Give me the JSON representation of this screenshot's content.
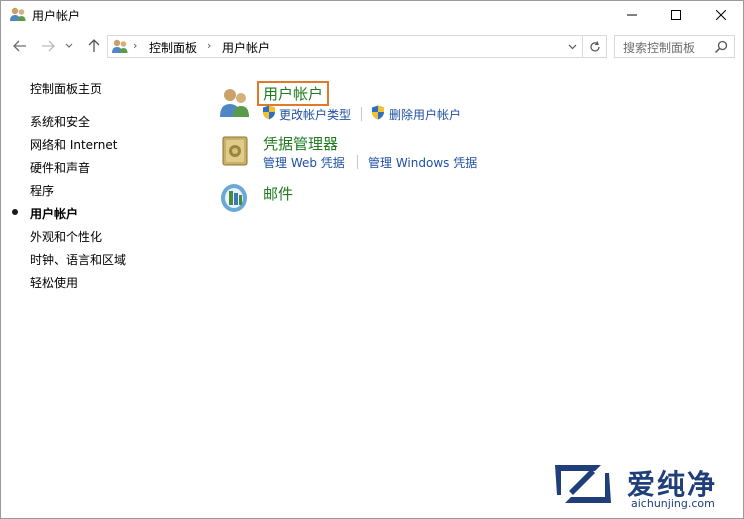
{
  "window": {
    "title": "用户帐户",
    "controls": {
      "minimize": "—",
      "maximize": "☐",
      "close": "✕"
    }
  },
  "navigation": {
    "back_icon": "arrow-left-icon",
    "forward_icon": "arrow-right-icon",
    "recent_icon": "chevron-down-icon",
    "up_icon": "arrow-up-icon",
    "address": {
      "separator": "›",
      "crumbs": [
        "控制面板",
        "用户帐户"
      ]
    },
    "search": {
      "placeholder": "搜索控制面板"
    }
  },
  "sidebar": {
    "home": "控制面板主页",
    "items": [
      {
        "label": "系统和安全",
        "selected": false
      },
      {
        "label": "网络和 Internet",
        "selected": false
      },
      {
        "label": "硬件和声音",
        "selected": false
      },
      {
        "label": "程序",
        "selected": false
      },
      {
        "label": "用户帐户",
        "selected": true
      },
      {
        "label": "外观和个性化",
        "selected": false
      },
      {
        "label": "时钟、语言和区域",
        "selected": false
      },
      {
        "label": "轻松使用",
        "selected": false
      }
    ]
  },
  "categories": [
    {
      "title": "用户帐户",
      "icon": "users-icon",
      "links": [
        "更改帐户类型",
        "删除用户帐户"
      ]
    },
    {
      "title": "凭据管理器",
      "icon": "credential-vault-icon",
      "links": [
        "管理 Web 凭据",
        "管理 Windows 凭据"
      ]
    },
    {
      "title": "邮件",
      "icon": "mail-icon",
      "links": []
    }
  ],
  "colors": {
    "category_title": "#1e7b1e",
    "link": "#1e50a2",
    "highlight_border": "#e07a2a",
    "watermark": "#1f3e7a"
  },
  "watermark": {
    "chars": "爱纯净",
    "url": "aichunjing.com"
  }
}
